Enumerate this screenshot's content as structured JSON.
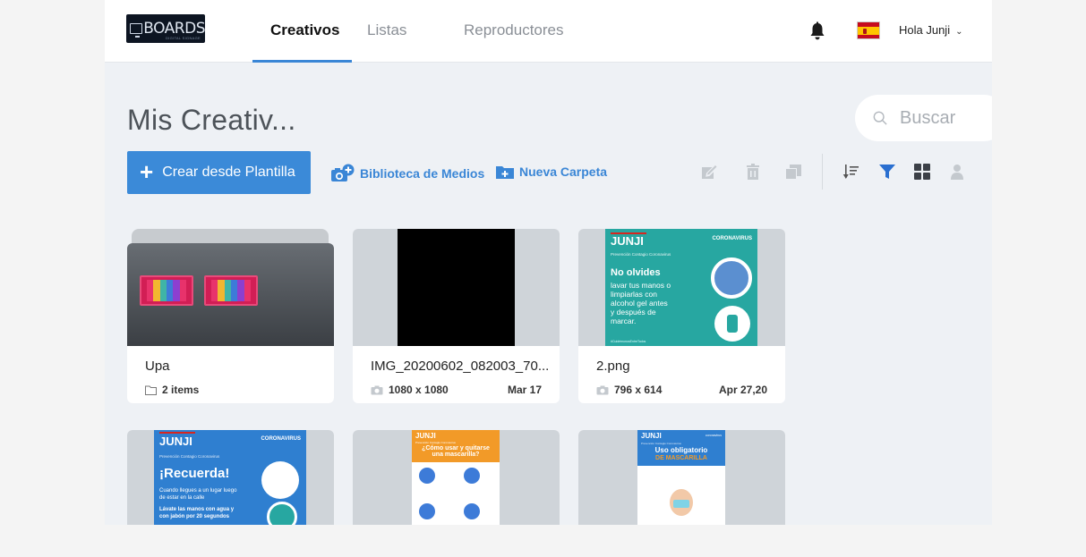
{
  "app": {
    "logo_text": "BOARDS",
    "logo_subtext": "DIGITAL SIGNAGE"
  },
  "nav": {
    "tabs": [
      {
        "label": "Creativos",
        "active": true
      },
      {
        "label": "Listas",
        "active": false
      },
      {
        "label": "Reproductores",
        "active": false
      }
    ],
    "user_label": "Hola Junji",
    "notifications_icon": "bell-icon",
    "language_flag": "spain-flag"
  },
  "header": {
    "title": "Mis Creativ...",
    "search_placeholder": "Buscar"
  },
  "toolbar": {
    "create_label": "Crear desde Plantilla",
    "media_library_label": "Biblioteca de Medios",
    "new_folder_label": "Nueva Carpeta",
    "icons": [
      "edit-icon",
      "trash-icon",
      "duplicate-icon",
      "sort-icon",
      "filter-icon",
      "grid-view-icon",
      "user-filter-icon"
    ],
    "accent_color": "#3a86d6",
    "filter_color": "#2a6fd0"
  },
  "items": [
    {
      "name": "Upa",
      "type": "folder",
      "meta": "2 items",
      "date": ""
    },
    {
      "name": "IMG_20200602_082003_70...",
      "type": "image",
      "meta": "1080 x 1080",
      "date": "Mar 17"
    },
    {
      "name": "2.png",
      "type": "image",
      "meta": "796 x 614",
      "date": "Apr 27,20"
    }
  ],
  "poster_2png": {
    "org": "JUNJI",
    "campaign": "CORONAVIRUS",
    "subtitle": "Prevención Contagio Coronavirus",
    "headline": "No olvides",
    "body": [
      "lavar tus manos o",
      "limpiarlas con",
      "alcohol gel antes",
      "y después de",
      "marcar."
    ],
    "hashtag": "#CuidémonosEntreTodos"
  },
  "poster_row2_a": {
    "org": "JUNJI",
    "campaign": "CORONAVIRUS",
    "subtitle": "Prevención Contagio Coronavirus",
    "headline": "¡Recuerda!",
    "body": [
      "Cuando llegues a un lugar luego",
      "de estar en la calle"
    ],
    "body2": "Lávate las manos con agua y",
    "body3": "con jabón por 20 segundos"
  },
  "poster_row2_b": {
    "org": "JUNJI",
    "subtitle": "Prevención Contagio Coronavirus",
    "headline": "¿Cómo usar y quitarse una mascarilla?"
  },
  "poster_row2_c": {
    "org": "JUNJI",
    "campaign": "coronavirus",
    "subtitle": "Prevención Contagio Coronavirus",
    "headline": "Uso obligatorio",
    "headline2": "DE MASCARILLA"
  }
}
